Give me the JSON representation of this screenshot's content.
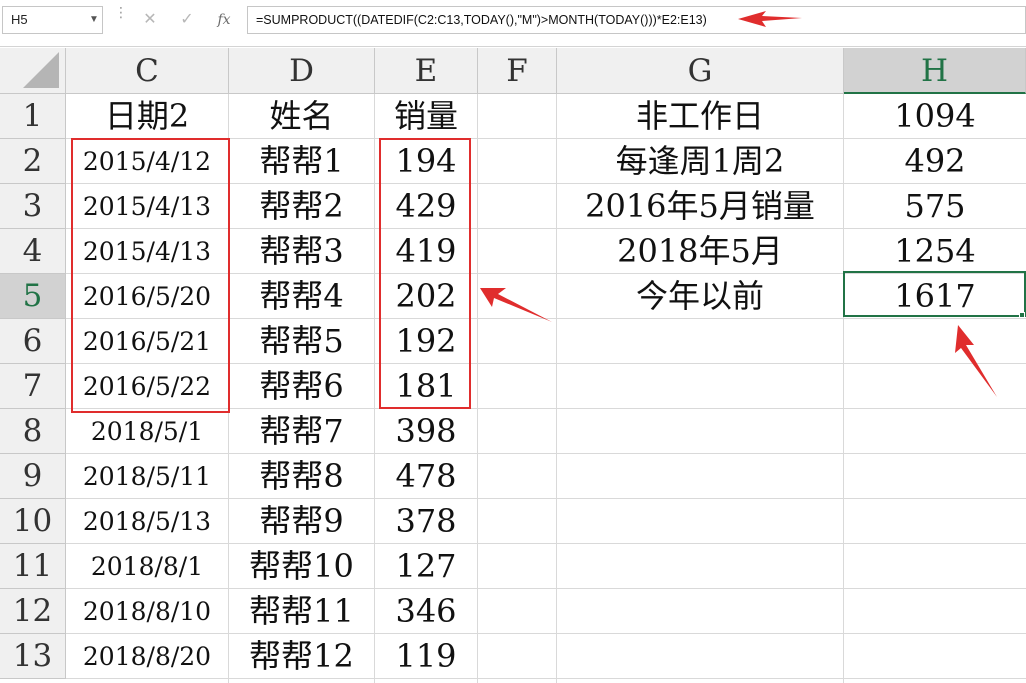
{
  "name_box": {
    "value": "H5"
  },
  "formula_bar": {
    "cancel_glyph": "✕",
    "enter_glyph": "✓",
    "fx_label": "fx",
    "formula": "=SUMPRODUCT((DATEDIF(C2:C13,TODAY(),\"M\")>MONTH(TODAY()))*E2:E13)"
  },
  "columns": [
    "C",
    "D",
    "E",
    "F",
    "G",
    "H"
  ],
  "selected_column": "H",
  "rows": [
    "1",
    "2",
    "3",
    "4",
    "5",
    "6",
    "7",
    "8",
    "9",
    "10",
    "11",
    "12",
    "13"
  ],
  "selected_row": "5",
  "table": {
    "headers": {
      "date": "日期2",
      "name": "姓名",
      "sales": "销量"
    },
    "records": [
      {
        "date": "2015/4/12",
        "name": "帮帮1",
        "sales": "194"
      },
      {
        "date": "2015/4/13",
        "name": "帮帮2",
        "sales": "429"
      },
      {
        "date": "2015/4/13",
        "name": "帮帮3",
        "sales": "419"
      },
      {
        "date": "2016/5/20",
        "name": "帮帮4",
        "sales": "202"
      },
      {
        "date": "2016/5/21",
        "name": "帮帮5",
        "sales": "192"
      },
      {
        "date": "2016/5/22",
        "name": "帮帮6",
        "sales": "181"
      },
      {
        "date": "2018/5/1",
        "name": "帮帮7",
        "sales": "398"
      },
      {
        "date": "2018/5/11",
        "name": "帮帮8",
        "sales": "478"
      },
      {
        "date": "2018/5/13",
        "name": "帮帮9",
        "sales": "378"
      },
      {
        "date": "2018/8/1",
        "name": "帮帮10",
        "sales": "127"
      },
      {
        "date": "2018/8/10",
        "name": "帮帮11",
        "sales": "346"
      },
      {
        "date": "2018/8/20",
        "name": "帮帮12",
        "sales": "119"
      }
    ]
  },
  "summary": [
    {
      "label": "非工作日",
      "value": "1094"
    },
    {
      "label": "每逢周1周2",
      "value": "492"
    },
    {
      "label": "2016年5月销量",
      "value": "575"
    },
    {
      "label": "2018年5月",
      "value": "1254"
    },
    {
      "label": "今年以前",
      "value": "1617"
    }
  ],
  "colors": {
    "annotation_red": "#e02d2d",
    "selection_green": "#217346"
  }
}
